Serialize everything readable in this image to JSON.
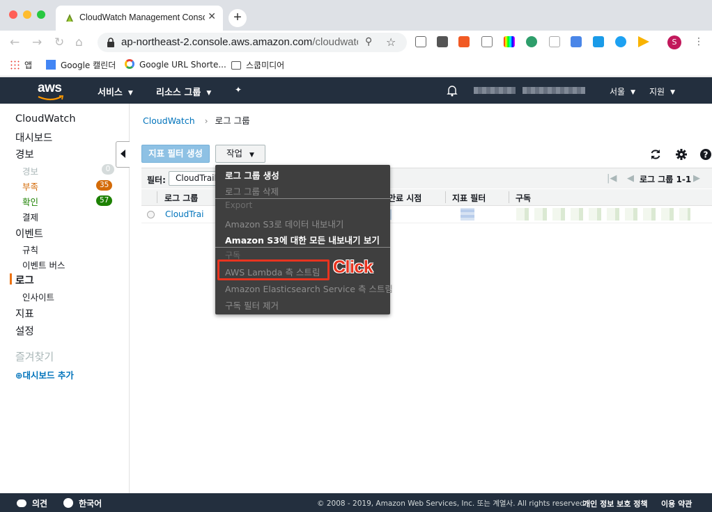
{
  "browser": {
    "tab_title": "CloudWatch Management Console",
    "tab_close": "✕",
    "new_tab": "+",
    "url_host": "ap-northeast-2.console.aws.amazon.com",
    "url_path": "/cloudwatch/home",
    "avatar_letter": "S",
    "bookmarks": [
      "앱",
      "Google 캘린더",
      "Google URL Shorte...",
      "스쿱미디어"
    ]
  },
  "aws_header": {
    "logo": "aws",
    "services": "서비스",
    "resource_groups": "리소스 그룹",
    "region": "서울",
    "support": "지원"
  },
  "sidebar": {
    "cloudwatch": "CloudWatch",
    "dashboards": "대시보드",
    "alarms": "경보",
    "alarm_sub": "경보",
    "alarm_count": "0",
    "insufficient": "부족",
    "insufficient_count": "35",
    "ok": "확인",
    "ok_count": "57",
    "billing": "결제",
    "events": "이벤트",
    "rules": "규칙",
    "event_buses": "이벤트 버스",
    "logs": "로그",
    "insights": "인사이트",
    "metrics": "지표",
    "settings": "설정",
    "favorites": "즐겨찾기",
    "add_dashboard": "대시보드 추가"
  },
  "main": {
    "breadcrumb_root": "CloudWatch",
    "breadcrumb_sep": "›",
    "breadcrumb_current": "로그 그룹",
    "create_metric_filter": "지표 필터 생성",
    "actions": "작업",
    "filter_label": "필터:",
    "filter_value": "CloudTrail",
    "pager_text": "로그 그룹 1-1",
    "columns": [
      "로그 그룹",
      "만료 시점",
      "지표 필터",
      "구독"
    ],
    "rows": [
      {
        "log_group": "CloudTrai"
      }
    ]
  },
  "dropdown": {
    "items": [
      {
        "label": "로그 그룹 생성",
        "state": "on"
      },
      {
        "label": "로그 그룹 삭제",
        "state": "off"
      },
      {
        "label": "Export",
        "state": "section"
      },
      {
        "label": "Amazon S3로 데이터 내보내기",
        "state": "off"
      },
      {
        "label": "Amazon S3에 대한 모든 내보내기 보기",
        "state": "on"
      },
      {
        "label": "구독",
        "state": "section"
      },
      {
        "label": "AWS Lambda 측 스트림",
        "state": "off"
      },
      {
        "label": "Amazon Elasticsearch Service 측 스트림",
        "state": "off"
      },
      {
        "label": "구독 필터 제거",
        "state": "off"
      }
    ]
  },
  "annotation": {
    "label": "Click",
    "color": "#e8341f"
  },
  "footer": {
    "feedback": "의견",
    "language": "한국어",
    "copyright": "© 2008 - 2019, Amazon Web Services, Inc. 또는 계열사. All rights reserved.",
    "privacy": "개인 정보 보호 정책",
    "terms": "이용 약관"
  },
  "colors": {
    "aws_header": "#232f3e",
    "link": "#0073bb",
    "primary_button": "#8ec1e4",
    "active_orange": "#ec7211",
    "ok_green": "#1d8102",
    "menu_bg": "#3f3f3f"
  }
}
